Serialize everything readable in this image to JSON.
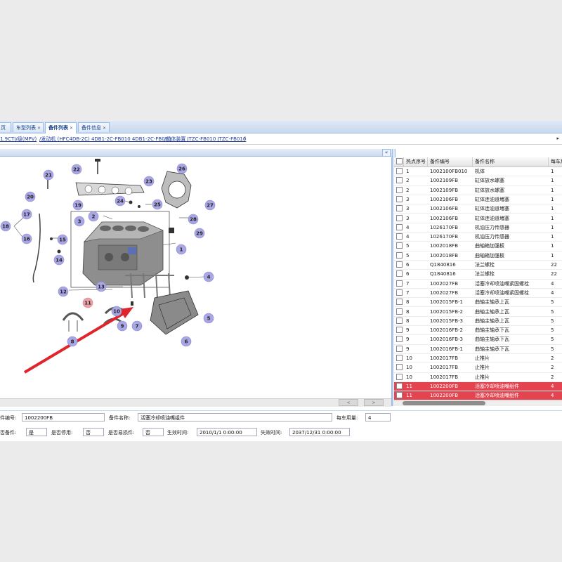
{
  "tabs": [
    {
      "label": "页",
      "closable": false
    },
    {
      "label": "车型列表",
      "closable": true
    },
    {
      "label": "备件列表",
      "closable": true
    },
    {
      "label": "备件信息",
      "closable": true
    }
  ],
  "breadcrumb": {
    "items": [
      "1.9CTI/级(MPV)",
      "/发动机 (HFC4DB-2C) 4DB1-2C-FB010 4DB1-2C-FB010",
      "/机体装置 JTZC-FB010 JTZC-FB010"
    ],
    "separator": "/",
    "more": "▸"
  },
  "diagram": {
    "collapse_label": "«",
    "callouts": [
      "1",
      "2",
      "3",
      "4",
      "5",
      "6",
      "7",
      "8",
      "9",
      "10",
      "11",
      "12",
      "13",
      "14",
      "15",
      "16",
      "17",
      "18",
      "19",
      "20",
      "21",
      "22",
      "23",
      "24",
      "25",
      "26",
      "27",
      "28",
      "29"
    ],
    "highlighted_callout": "11",
    "scroll_left": "<",
    "scroll_right": ">"
  },
  "table": {
    "columns": [
      "热点序号",
      "备件编号",
      "备件名称",
      "每车用"
    ],
    "rows": [
      {
        "hot": "1",
        "code": "1002100FB010",
        "name": "机体",
        "qty": "1",
        "highlight": false
      },
      {
        "hot": "2",
        "code": "1002109FB",
        "name": "缸体放水螺塞",
        "qty": "1",
        "highlight": false
      },
      {
        "hot": "2",
        "code": "1002109FB",
        "name": "缸体放水螺塞",
        "qty": "1",
        "highlight": false
      },
      {
        "hot": "3",
        "code": "1002106FB",
        "name": "缸体连油道堵塞",
        "qty": "1",
        "highlight": false
      },
      {
        "hot": "3",
        "code": "1002106FB",
        "name": "缸体连油道堵塞",
        "qty": "1",
        "highlight": false
      },
      {
        "hot": "3",
        "code": "1002106FB",
        "name": "缸体连油道堵塞",
        "qty": "1",
        "highlight": false
      },
      {
        "hot": "4",
        "code": "1026170FB",
        "name": "机油压力传感器",
        "qty": "1",
        "highlight": false
      },
      {
        "hot": "4",
        "code": "1026170FB",
        "name": "机油压力传感器",
        "qty": "1",
        "highlight": false
      },
      {
        "hot": "5",
        "code": "1002018FB",
        "name": "曲轴箱加强板",
        "qty": "1",
        "highlight": false
      },
      {
        "hot": "5",
        "code": "1002018FB",
        "name": "曲轴箱加强板",
        "qty": "1",
        "highlight": false
      },
      {
        "hot": "6",
        "code": "Q1840816",
        "name": "法兰螺栓",
        "qty": "22",
        "highlight": false
      },
      {
        "hot": "6",
        "code": "Q1840816",
        "name": "法兰螺栓",
        "qty": "22",
        "highlight": false
      },
      {
        "hot": "7",
        "code": "1002027FB",
        "name": "活塞冷却喷油嘴紧固螺栓",
        "qty": "4",
        "highlight": false
      },
      {
        "hot": "7",
        "code": "1002027FB",
        "name": "活塞冷却喷油嘴紧固螺栓",
        "qty": "4",
        "highlight": false
      },
      {
        "hot": "8",
        "code": "1002015FB-1",
        "name": "曲轴主轴承上瓦",
        "qty": "5",
        "highlight": false
      },
      {
        "hot": "8",
        "code": "1002015FB-2",
        "name": "曲轴主轴承上瓦",
        "qty": "5",
        "highlight": false
      },
      {
        "hot": "8",
        "code": "1002015FB-3",
        "name": "曲轴主轴承上瓦",
        "qty": "5",
        "highlight": false
      },
      {
        "hot": "9",
        "code": "1002016FB-2",
        "name": "曲轴主轴承下瓦",
        "qty": "5",
        "highlight": false
      },
      {
        "hot": "9",
        "code": "1002016FB-3",
        "name": "曲轴主轴承下瓦",
        "qty": "5",
        "highlight": false
      },
      {
        "hot": "9",
        "code": "1002016FB-1",
        "name": "曲轴主轴承下瓦",
        "qty": "5",
        "highlight": false
      },
      {
        "hot": "10",
        "code": "1002017FB",
        "name": "止推片",
        "qty": "2",
        "highlight": false
      },
      {
        "hot": "10",
        "code": "1002017FB",
        "name": "止推片",
        "qty": "2",
        "highlight": false
      },
      {
        "hot": "10",
        "code": "1002017FB",
        "name": "止推片",
        "qty": "2",
        "highlight": false
      },
      {
        "hot": "11",
        "code": "1002200FB",
        "name": "活塞冷却喷油嘴组件",
        "qty": "4",
        "highlight": true
      },
      {
        "hot": "11",
        "code": "1002200FB",
        "name": "活塞冷却喷油嘴组件",
        "qty": "4",
        "highlight": true
      }
    ],
    "highlight_color": "#e4444f"
  },
  "form": {
    "part_no_label": "件编号:",
    "part_no_value": "1002200FB",
    "part_name_label": "备件名称:",
    "part_name_value": "活塞冷却喷油嘴组件",
    "qty_label": "每车用量:",
    "qty_value": "4",
    "spare_label": "否备件:",
    "spare_value": "是",
    "discontinued_label": "是否停用:",
    "discontinued_value": "否",
    "wear_label": "是否易损件:",
    "wear_value": "否",
    "effective_label": "生效时间:",
    "effective_value": "2010/1/1 0:00:00",
    "expiry_label": "失效时间:",
    "expiry_value": "2037/12/31 0:00:00"
  }
}
